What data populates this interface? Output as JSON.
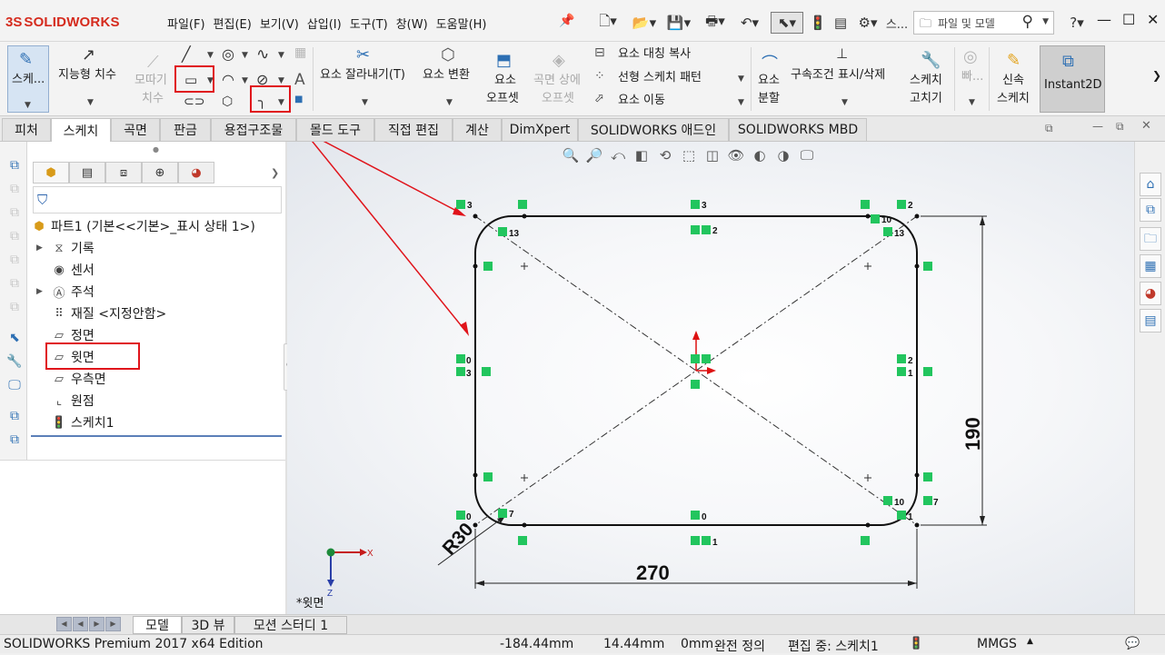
{
  "app": {
    "logo_ds": "3S",
    "logo_name": "SOLIDWORKS",
    "menu": [
      "파일(F)",
      "편집(E)",
      "보기(V)",
      "삽입(I)",
      "도구(T)",
      "창(W)",
      "도움말(H)"
    ],
    "search_placeholder": "파일 및 모델",
    "search_short": "스...",
    "help": "?"
  },
  "commandmanager": {
    "sketch": "스케...",
    "smart_dimension": "지능형 치수",
    "fillet_line1": "모따기",
    "fillet_line2": "치수",
    "trim": "요소 잘라내기(T)",
    "convert": "요소 변환",
    "offset_line1": "요소",
    "offset_line2": "오프셋",
    "offset_surface_line1": "곡면 상에",
    "offset_surface_line2": "오프셋",
    "mirror": "요소 대칭 복사",
    "linear_pattern": "선형 스케치 패턴",
    "move": "요소 이동",
    "split_line1": "요소",
    "split_line2": "분할",
    "relations": "구속조건 표시/삭제",
    "repair_line1": "스케치",
    "repair_line2": "고치기",
    "quick_snaps": "빠...",
    "rapid_line1": "신속",
    "rapid_line2": "스케치",
    "instant2d": "Instant2D"
  },
  "tabs": [
    "피처",
    "스케치",
    "곡면",
    "판금",
    "용접구조물",
    "몰드 도구",
    "직접 편집",
    "계산",
    "DimXpert",
    "SOLIDWORKS 애드인",
    "SOLIDWORKS MBD"
  ],
  "active_tab": "스케치",
  "tree": {
    "root": "파트1  (기본<<기본>_표시 상태 1>)",
    "items": [
      "기록",
      "센서",
      "주석",
      "재질 <지정안함>",
      "정면",
      "윗면",
      "우측면",
      "원점",
      "스케치1"
    ]
  },
  "sketch": {
    "width_dim": "270",
    "height_dim": "190",
    "radius_dim": "R30",
    "view_label": "*윗면",
    "triad_x": "X",
    "triad_z": "Z",
    "relation_labels": {
      "tl_top": "3",
      "tl_inner": "13",
      "tm_top": "3",
      "tm_inner": "2",
      "tr_top": "2",
      "tr_mid": "10",
      "tr_inner": "13",
      "l_mid_a": "0",
      "l_mid_b": "3",
      "r_mid_a": "2",
      "r_mid_b": "1",
      "bl_bot": "0",
      "bl_inner": "7",
      "bm_bot": "0",
      "bm_outer": "1",
      "br_mid": "10",
      "br_side": "7",
      "br_bot": "1"
    }
  },
  "bottom_tabs": [
    "모델",
    "3D 뷰",
    "모션 스터디 1"
  ],
  "status": {
    "edition": "SOLIDWORKS Premium 2017 x64 Edition",
    "x": "-184.44mm",
    "y": "14.44mm",
    "z": "0mm",
    "state": "완전 정의",
    "editing": "편집 중: 스케치1",
    "units": "MMGS"
  },
  "colors": {
    "accent_red": "#d52b1e",
    "annotation_red": "#e0141b",
    "relation_green": "#22c55e",
    "sketch_black": "#000000"
  }
}
